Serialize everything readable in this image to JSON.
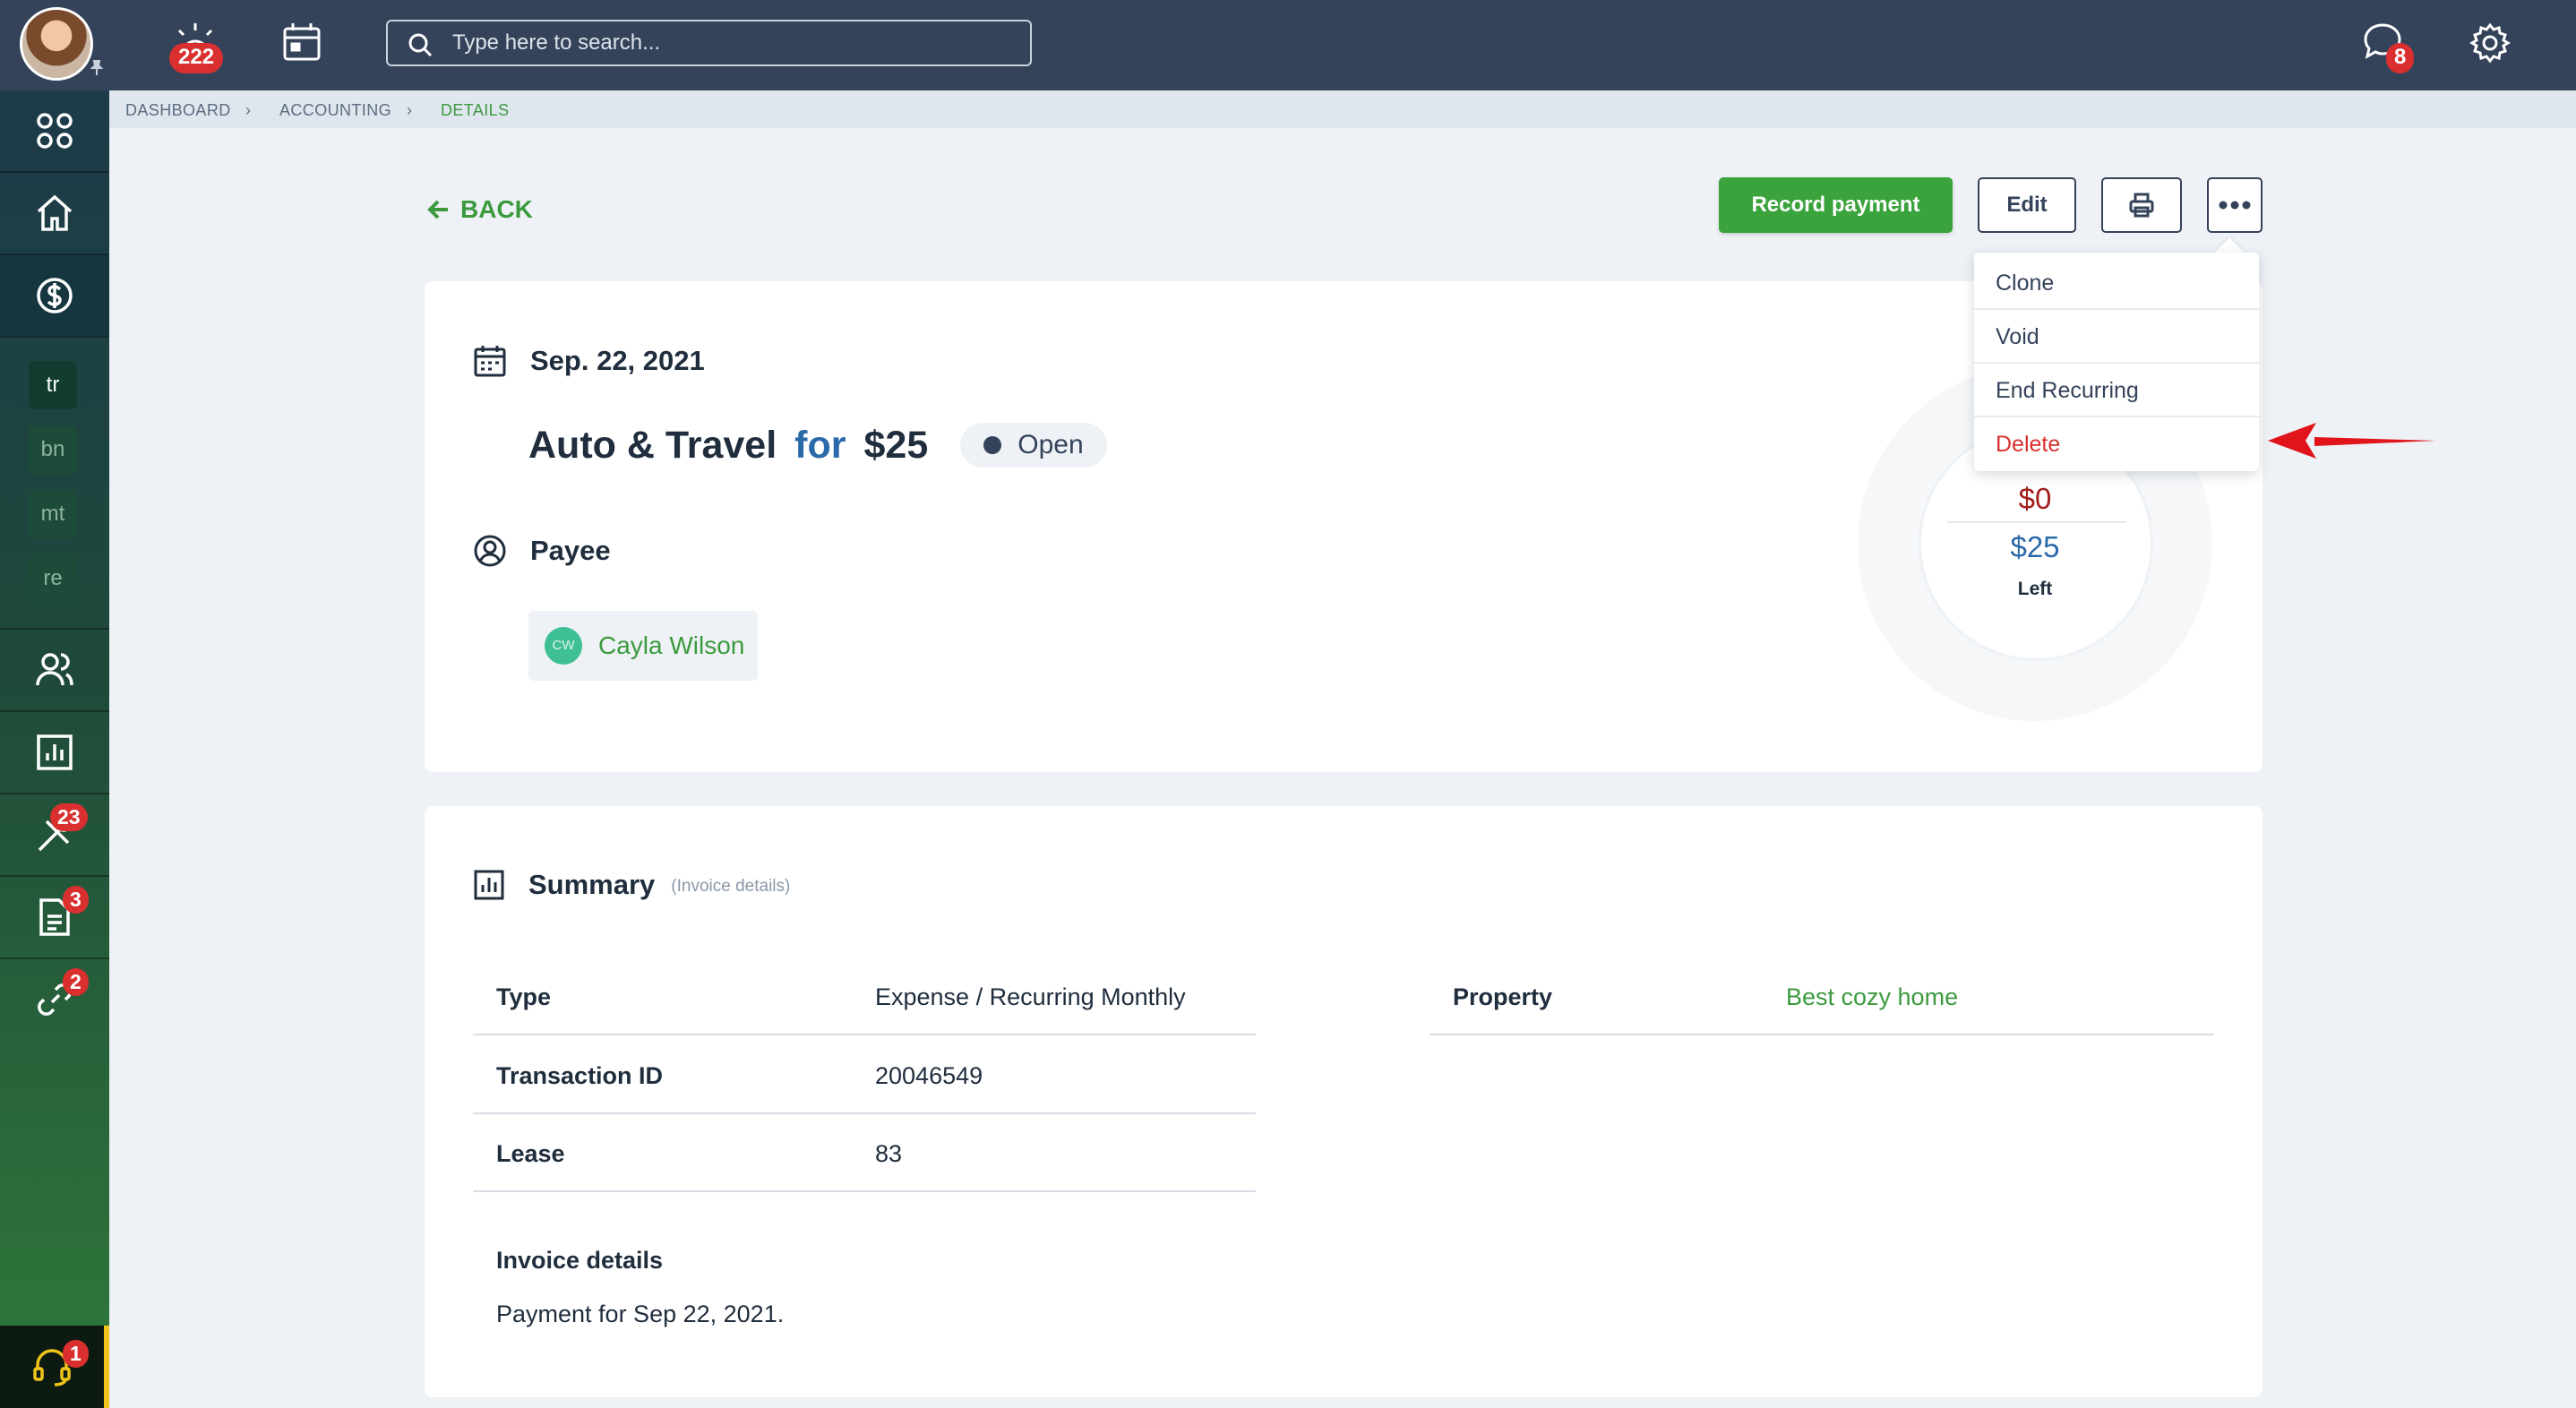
{
  "topbar": {
    "notifications_count": "222",
    "search_placeholder": "Type here to search...",
    "messages_count": "8"
  },
  "sidebar": {
    "chips": [
      "tr",
      "bn",
      "mt",
      "re"
    ],
    "maintenance_badge": "23",
    "documents_badge": "3",
    "links_badge": "2",
    "help_badge": "1"
  },
  "breadcrumb": [
    "DASHBOARD",
    "ACCOUNTING",
    "DETAILS"
  ],
  "actions": {
    "back_label": "BACK",
    "record_payment_label": "Record payment",
    "edit_label": "Edit"
  },
  "menu": {
    "items": [
      "Clone",
      "Void",
      "End Recurring",
      "Delete"
    ]
  },
  "transaction": {
    "date": "Sep. 22, 2021",
    "category": "Auto & Travel",
    "for_label": "for",
    "amount": "$25",
    "status": "Open",
    "payee_heading": "Payee",
    "payee_initials": "CW",
    "payee_name": "Cayla Wilson",
    "paid_amount": "$0",
    "left_amount": "$25",
    "left_label": "Left"
  },
  "summary": {
    "title": "Summary",
    "subtitle": "(Invoice details)",
    "rows": [
      {
        "label": "Type",
        "value": "Expense / Recurring Monthly"
      },
      {
        "label": "Transaction ID",
        "value": "20046549"
      },
      {
        "label": "Lease",
        "value": "83"
      }
    ],
    "property_label": "Property",
    "property_value": "Best cozy home",
    "invoice_label": "Invoice details",
    "invoice_value": "Payment for Sep 22, 2021."
  },
  "colors": {
    "topbar": "#34435a",
    "primary": "#3aa33c",
    "danger": "#d9302f",
    "link_blue": "#2b6aa8"
  },
  "icons": {
    "topbar": [
      "avatar",
      "pin-icon",
      "alarm-icon",
      "calendar-icon",
      "search-icon",
      "chat-icon",
      "gear-icon"
    ],
    "sidebar": [
      "apps-grid-icon",
      "home-icon",
      "dollar-icon",
      "users-icon",
      "chart-icon",
      "tools-icon",
      "document-icon",
      "link-icon",
      "headset-icon"
    ]
  }
}
